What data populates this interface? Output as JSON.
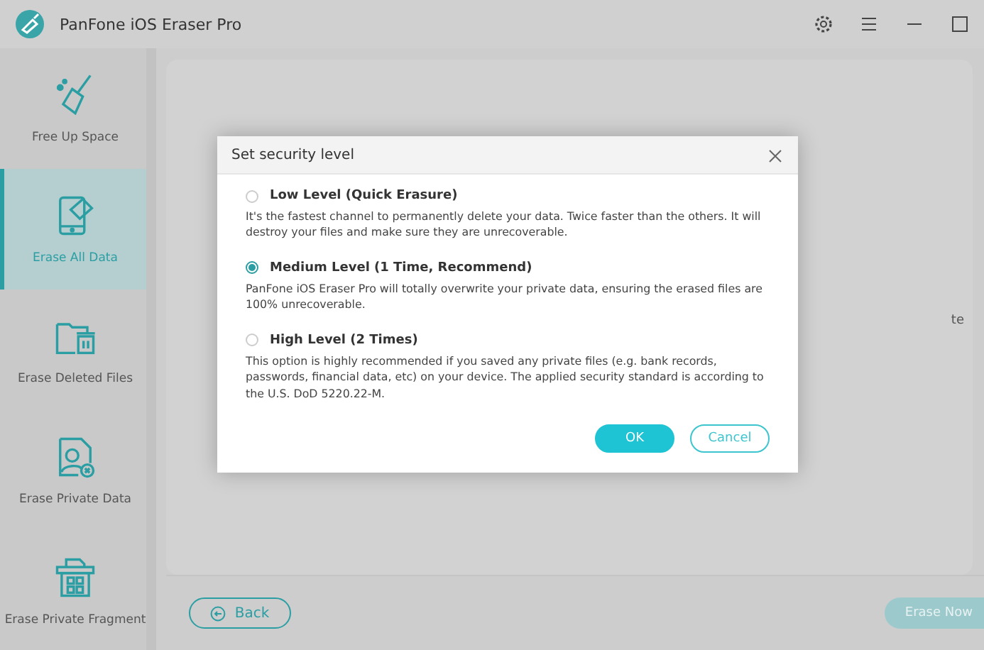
{
  "window": {
    "title": "PanFone iOS Eraser Pro"
  },
  "sidebar": {
    "items": [
      {
        "label": "Free Up Space",
        "kind": "broom",
        "selected": false
      },
      {
        "label": "Erase All Data",
        "kind": "phone",
        "selected": true
      },
      {
        "label": "Erase Deleted Files",
        "kind": "folder",
        "selected": false
      },
      {
        "label": "Erase Private Data",
        "kind": "person",
        "selected": false
      },
      {
        "label": "Erase Private Fragment",
        "kind": "grid",
        "selected": false
      }
    ]
  },
  "main": {
    "background_text": "te",
    "back_button": "Back",
    "erase_button": "Erase Now"
  },
  "dialog": {
    "title": "Set security level",
    "options": [
      {
        "label": "Low Level (Quick Erasure)",
        "description": "It's the fastest channel to permanently delete your data. Twice faster than the others. It will destroy your files and make sure they are unrecoverable.",
        "selected": false
      },
      {
        "label": "Medium Level (1 Time, Recommend)",
        "description": "PanFone iOS Eraser Pro will totally overwrite your private data, ensuring the erased files are 100% unrecoverable.",
        "selected": true
      },
      {
        "label": "High Level (2 Times)",
        "description": "This option is highly recommended if you saved any private files (e.g. bank records, passwords, financial data, etc) on your device. The applied security standard is according to the U.S. DoD 5220.22-M.",
        "selected": false
      }
    ],
    "buttons": [
      {
        "label": "OK",
        "kind": "primary"
      },
      {
        "label": "Cancel",
        "kind": "secondary"
      }
    ]
  }
}
